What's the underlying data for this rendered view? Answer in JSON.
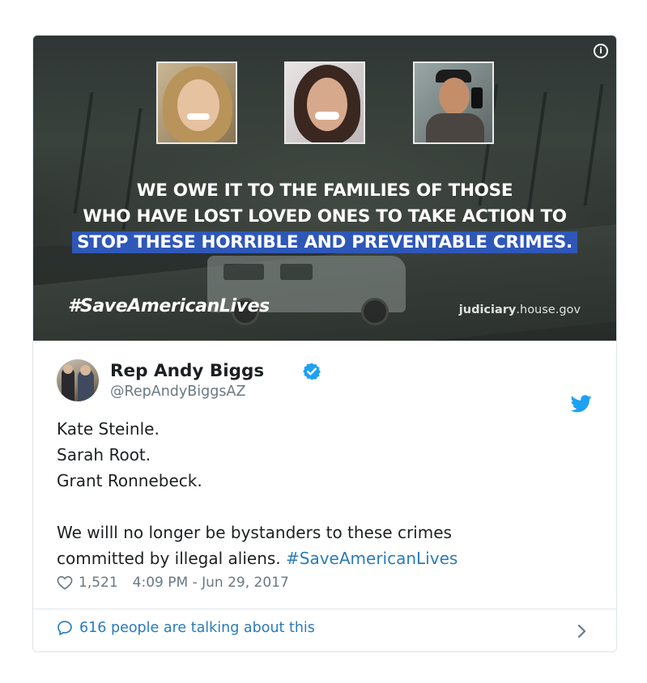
{
  "image": {
    "headline_lines": [
      "WE OWE IT TO THE FAMILIES OF THOSE",
      "WHO HAVE LOST LOVED ONES TO TAKE ACTION TO",
      "STOP THESE HORRIBLE AND PREVENTABLE CRIMES."
    ],
    "hashtag": "#SaveAmericanLives",
    "domain_bold": "judiciary",
    "domain_rest": ".house.gov",
    "highlight_color": "#2e57b8"
  },
  "tweet": {
    "author_name": "Rep Andy Biggs",
    "author_handle": "@RepAndyBiggsAZ",
    "lines": [
      "Kate Steinle.",
      "Sarah Root.",
      "Grant Ronnebeck."
    ],
    "body_line1": "We willl no longer be bystanders to these crimes",
    "body_line2_text": "committed by illegal aliens.",
    "body_line2_hashtag": "#SaveAmericanLives",
    "likes": "1,521",
    "timestamp": "4:09 PM - Jun 29, 2017",
    "talking": "616 people are talking about this",
    "link_color": "#2b7bb9",
    "icons": [
      "info-icon",
      "verified-badge-icon",
      "twitter-bird-icon",
      "heart-icon",
      "speech-bubble-icon",
      "chevron-right-icon"
    ]
  }
}
